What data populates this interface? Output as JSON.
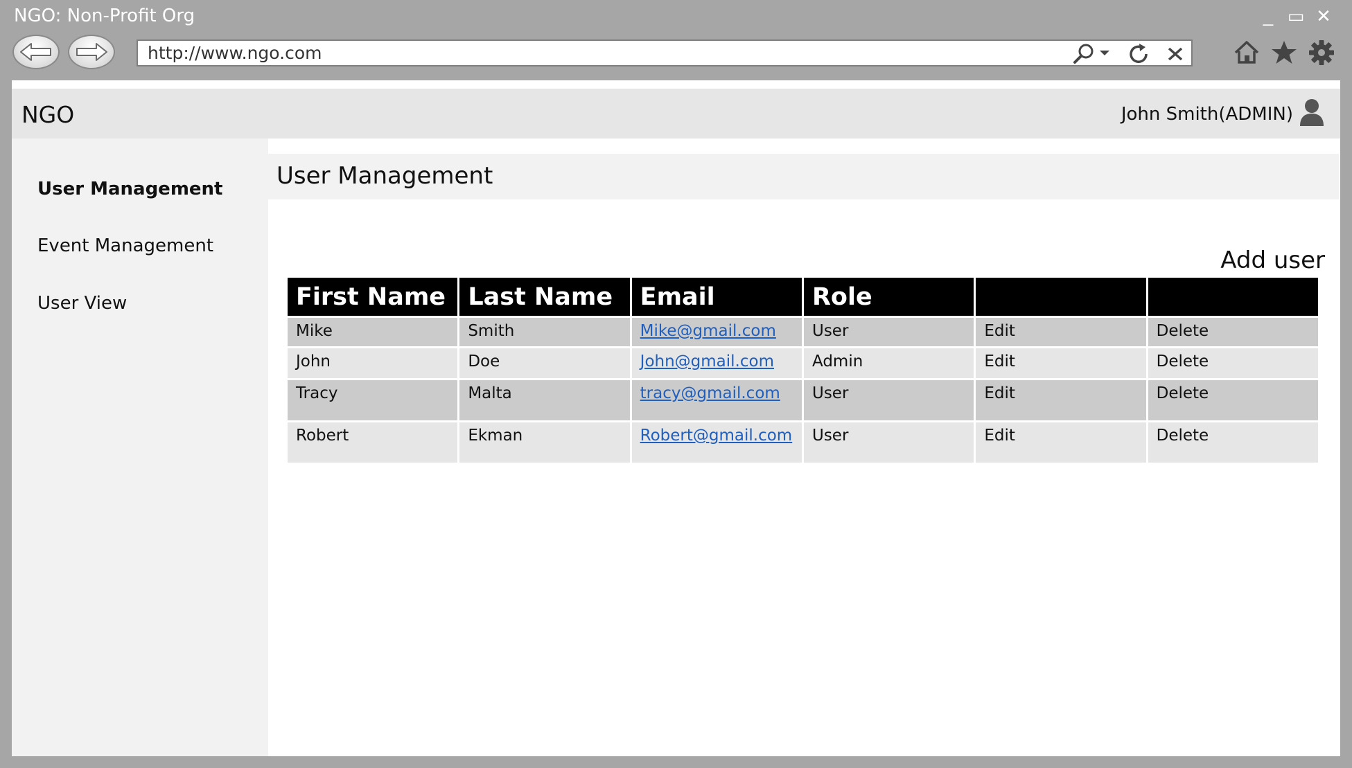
{
  "window": {
    "title": "NGO: Non-Profit Org",
    "controls": [
      "_",
      "▭",
      "✕"
    ]
  },
  "browser": {
    "url": "http://www.ngo.com",
    "icons": [
      "back-arrow-icon",
      "forward-arrow-icon",
      "search-icon",
      "refresh-icon",
      "close-icon",
      "home-icon",
      "star-icon",
      "gear-icon"
    ]
  },
  "header": {
    "brand": "NGO",
    "user": "John Smith(ADMIN)"
  },
  "sidebar": {
    "items": [
      {
        "label": "User Management",
        "active": true
      },
      {
        "label": "Event Management",
        "active": false
      },
      {
        "label": "User View",
        "active": false
      }
    ]
  },
  "main": {
    "title": "User Management",
    "add_user": "Add user",
    "table": {
      "columns": [
        "First Name",
        "Last Name",
        "Email",
        "Role",
        "",
        ""
      ],
      "rows": [
        {
          "first": "Mike",
          "last": "Smith",
          "email": "Mike@gmail.com",
          "role": "User",
          "edit": "Edit",
          "delete": "Delete"
        },
        {
          "first": "John",
          "last": "Doe",
          "email": "John@gmail.com",
          "role": "Admin",
          "edit": "Edit",
          "delete": "Delete"
        },
        {
          "first": "Tracy",
          "last": "Malta",
          "email": "tracy@gmail.com",
          "role": "User",
          "edit": "Edit",
          "delete": "Delete"
        },
        {
          "first": "Robert",
          "last": "Ekman",
          "email": "Robert@gmail.com",
          "role": "User",
          "edit": "Edit",
          "delete": "Delete"
        }
      ]
    }
  },
  "colors": {
    "chrome": "#a6a6a6",
    "header_bg": "#e6e6e6",
    "sidebar_bg": "#f2f2f2",
    "table_header": "#000000",
    "row_dark": "#cbcbcb",
    "row_light": "#e6e6e6",
    "link": "#1f5fbf"
  }
}
